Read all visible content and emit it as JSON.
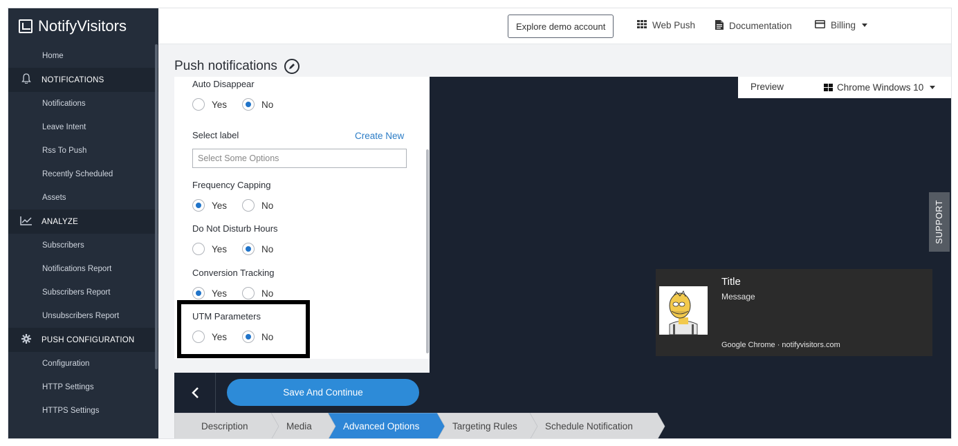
{
  "brand": {
    "name": "NotifyVisitors"
  },
  "sidebar": {
    "items": [
      {
        "label": "Home",
        "type": "item"
      },
      {
        "label": "NOTIFICATIONS",
        "type": "section",
        "icon": "bell-icon"
      },
      {
        "label": "Notifications",
        "type": "item"
      },
      {
        "label": "Leave Intent",
        "type": "item"
      },
      {
        "label": "Rss To Push",
        "type": "item"
      },
      {
        "label": "Recently Scheduled",
        "type": "item"
      },
      {
        "label": "Assets",
        "type": "item"
      },
      {
        "label": "ANALYZE",
        "type": "section",
        "icon": "chart-icon"
      },
      {
        "label": "Subscribers",
        "type": "item"
      },
      {
        "label": "Notifications Report",
        "type": "item"
      },
      {
        "label": "Subscribers Report",
        "type": "item"
      },
      {
        "label": "Unsubscribers Report",
        "type": "item"
      },
      {
        "label": "PUSH CONFIGURATION",
        "type": "section",
        "icon": "gear-icon"
      },
      {
        "label": "Configuration",
        "type": "item"
      },
      {
        "label": "HTTP Settings",
        "type": "item"
      },
      {
        "label": "HTTPS Settings",
        "type": "item"
      }
    ]
  },
  "topbar": {
    "demo_button": "Explore demo account",
    "web_push": "Web Push",
    "documentation": "Documentation",
    "billing": "Billing"
  },
  "page": {
    "title": "Push notifications"
  },
  "form": {
    "auto_disappear": {
      "label": "Auto Disappear",
      "yes": "Yes",
      "no": "No",
      "selected": "No"
    },
    "select_label": {
      "label": "Select label",
      "create_new": "Create New",
      "placeholder": "Select Some Options"
    },
    "frequency_capping": {
      "label": "Frequency Capping",
      "yes": "Yes",
      "no": "No",
      "selected": "Yes"
    },
    "dnd_hours": {
      "label": "Do Not Disturb Hours",
      "yes": "Yes",
      "no": "No",
      "selected": "No"
    },
    "conversion_tracking": {
      "label": "Conversion Tracking",
      "yes": "Yes",
      "no": "No",
      "selected": "Yes"
    },
    "utm_parameters": {
      "label": "UTM Parameters",
      "yes": "Yes",
      "no": "No",
      "selected": "No"
    }
  },
  "actions": {
    "save": "Save And Continue"
  },
  "preview": {
    "label": "Preview",
    "os": "Chrome Windows 10",
    "support": "SUPPORT",
    "notification": {
      "title": "Title",
      "message": "Message",
      "source": "Google Chrome · notifyvisitors.com"
    }
  },
  "steps": [
    {
      "label": "Description",
      "active": false
    },
    {
      "label": "Media",
      "active": false
    },
    {
      "label": "Advanced Options",
      "active": true
    },
    {
      "label": "Targeting Rules",
      "active": false
    },
    {
      "label": "Schedule Notification",
      "active": false
    }
  ],
  "colors": {
    "sidebar_bg": "#242d3a",
    "accent": "#2d8bd8",
    "step_active": "#2e86d6",
    "step_inactive": "#d9dadc",
    "preview_bg": "#1a2230"
  }
}
